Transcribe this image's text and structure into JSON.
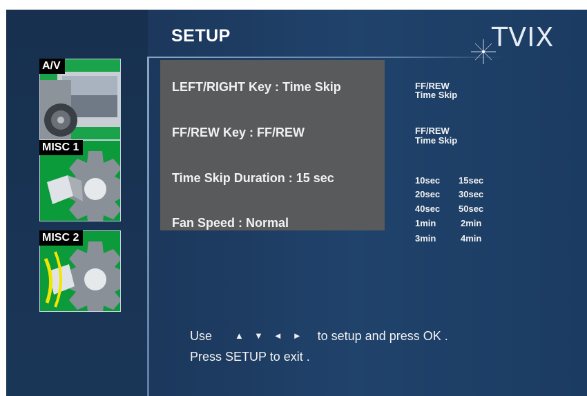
{
  "header": {
    "title": "SETUP",
    "logo_text": "TVIX"
  },
  "tabs": [
    {
      "label": "A/V",
      "icon": "speaker-tv-icon"
    },
    {
      "label": "MISC 1",
      "icon": "gear-icon"
    },
    {
      "label": "MISC 2",
      "icon": "gear-icon"
    }
  ],
  "menu": {
    "items": [
      {
        "label": "LEFT/RIGHT Key : Time Skip"
      },
      {
        "label": "FF/REW Key : FF/REW"
      },
      {
        "label": "Time Skip Duration  : 15 sec"
      },
      {
        "label": "Fan Speed : Normal"
      }
    ]
  },
  "options": {
    "left_right_key": [
      "FF/REW",
      "Time Skip"
    ],
    "ffrew_key": [
      "FF/REW",
      "Time Skip"
    ],
    "time_skip_duration": [
      [
        "10sec",
        "15sec"
      ],
      [
        "20sec",
        "30sec"
      ],
      [
        "40sec",
        "50sec"
      ],
      [
        "1min",
        "2min"
      ],
      [
        "3min",
        "4min"
      ]
    ]
  },
  "help": {
    "line1_prefix": "Use",
    "arrows": [
      "▲",
      "▼",
      "◄",
      "►"
    ],
    "line1_suffix": "to setup and press OK .",
    "line2": "Press SETUP to exit ."
  },
  "colors": {
    "background": "#1d3a60",
    "menu_box": "#585a5c",
    "tab_green": "#0b9b3a"
  }
}
